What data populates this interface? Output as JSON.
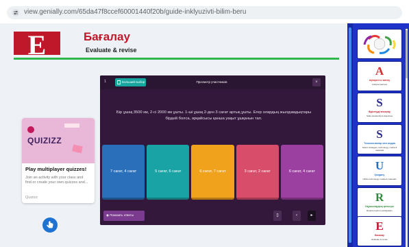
{
  "browser": {
    "url": "view.genially.com/65da47f8ccef60001440f20b/guide-inklyuzivti-bilim-beru"
  },
  "header": {
    "logo_letter": "E",
    "title": "Бағалау",
    "subtitle": "Evaluate & revise"
  },
  "quizizz_card": {
    "logo_text": "QUIZIZZ",
    "title": "Play multiplayer quizzes!",
    "description": "Join an activity with your class and find or create your own quizzes and...",
    "source": "Quizizz"
  },
  "quiz": {
    "question_number": "1",
    "big_button_label": "Больший выбор",
    "view_participants_label": "Просмотр участников",
    "close_label": "×",
    "question_text": "Бір ұшақ 3500 км, 2-сі 2000 км ұшты. 1-ші ұшақ 2-ден 3 сағат артық ұшты. Егер олардың жылдамдықтары бірдей болса, әрқайсысы қанша уақыт ұшқанын тап.",
    "answers": [
      {
        "label": "7 сағат, 4 сағат",
        "color": "#2a6fba"
      },
      {
        "label": "5 сағат, 6 сағат",
        "color": "#19a3a5"
      },
      {
        "label": "6 сағат, 7 сағат",
        "color": "#f0a21c"
      },
      {
        "label": "3 сағат, 2 сағат",
        "color": "#d84d6a"
      },
      {
        "label": "6 сағат, 4 сағат",
        "color": "#9b3fa0"
      }
    ],
    "show_answers_label": "Показать ответы"
  },
  "thumbnails": [
    {
      "letter": "",
      "caption": "",
      "sub": "",
      "color": "#d32f2f"
    },
    {
      "letter": "A",
      "caption": "Ақпаратты жинау",
      "sub": "Analyse learners",
      "color": "#d32f2f"
    },
    {
      "letter": "S",
      "caption": "Әдістерді анықтау",
      "sub": "State standards & objectives",
      "color": "#2a2a8a"
    },
    {
      "letter": "S",
      "caption": "Технологиялар мен медиа",
      "sub": "Select strategies, technology, media & materials",
      "color": "#2a2a8a"
    },
    {
      "letter": "U",
      "caption": "Қолдану",
      "sub": "Utilize technology, media & materials",
      "color": "#1e6fc8"
    },
    {
      "letter": "R",
      "caption": "Оқушылардың қатысуы",
      "sub": "Require learner participation",
      "color": "#2e8b3a"
    },
    {
      "letter": "E",
      "caption": "Бағалау",
      "sub": "Evaluate & revise",
      "color": "#c0182b"
    }
  ]
}
